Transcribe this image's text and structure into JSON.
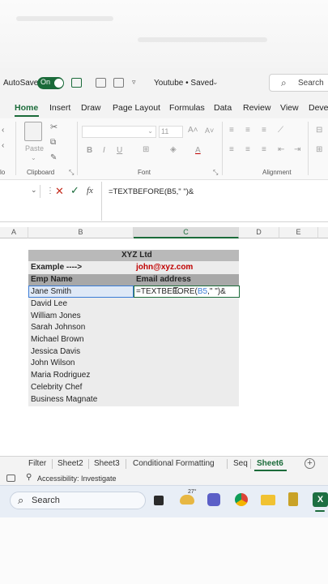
{
  "titlebar": {
    "autosave_label": "AutoSave",
    "autosave_state": "On",
    "doc_title": "Youtube • Saved",
    "search_placeholder": "Search"
  },
  "tabs": [
    "Home",
    "Insert",
    "Draw",
    "Page Layout",
    "Formulas",
    "Data",
    "Review",
    "View",
    "Deve"
  ],
  "ribbon": {
    "clipboard_label": "Clipboard",
    "paste_label": "Paste",
    "font_label": "Font",
    "alignment_label": "Alignment",
    "font_size": "11",
    "partial_label": "lo"
  },
  "formula_bar": {
    "formula": "=TEXTBEFORE(B5,\" \")&",
    "fx": "fx"
  },
  "columns": [
    "A",
    "B",
    "C",
    "D",
    "E"
  ],
  "sheet": {
    "title": "XYZ Ltd",
    "example_label": "Example ---->",
    "example_value": "john@xyz.com",
    "header_name": "Emp Name",
    "header_email": "Email address",
    "editing_formula_prefix": "=TEXTBEFORE(",
    "editing_formula_ref": "B5",
    "editing_formula_suffix": ",\" \")&",
    "names": [
      "Jane Smith",
      "David Lee",
      "William Jones",
      "Sarah Johnson",
      "Michael Brown",
      "Jessica Davis",
      "John Wilson",
      "Maria Rodriguez",
      "Celebrity Chef",
      "Business Magnate"
    ]
  },
  "sheet_tabs": [
    "Filter",
    "Sheet2",
    "Sheet3",
    "Conditional Formatting",
    "Seq",
    "Sheet6"
  ],
  "active_sheet": "Sheet6",
  "status": {
    "accessibility": "Accessibility: Investigate"
  },
  "taskbar": {
    "search_label": "Search",
    "weather_temp": "27°"
  },
  "colors": {
    "accent": "#1b6b3a",
    "example_red": "#c00000",
    "ref_blue": "#3a7bd5"
  }
}
